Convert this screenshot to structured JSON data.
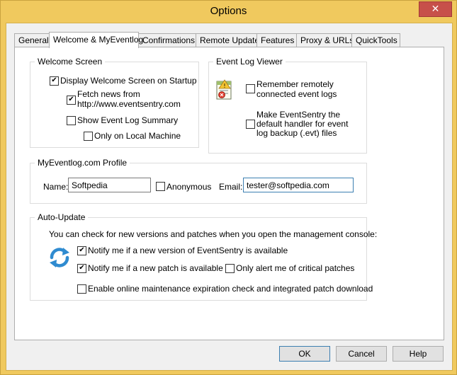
{
  "window": {
    "title": "Options",
    "close_glyph": "✕"
  },
  "tabs": [
    {
      "label": "General",
      "active": false
    },
    {
      "label": "Welcome & MyEventlog",
      "active": true
    },
    {
      "label": "Confirmations",
      "active": false
    },
    {
      "label": "Remote Update",
      "active": false
    },
    {
      "label": "Features",
      "active": false
    },
    {
      "label": "Proxy & URLs",
      "active": false
    },
    {
      "label": "QuickTools",
      "active": false
    }
  ],
  "welcome_screen": {
    "legend": "Welcome Screen",
    "display_on_startup": {
      "label": "Display Welcome Screen on Startup",
      "checked": true
    },
    "fetch_news": {
      "label_line1": "Fetch news from",
      "label_line2": "http://www.eventsentry.com",
      "checked": true
    },
    "show_summary": {
      "label": "Show Event Log Summary",
      "checked": false
    },
    "only_local": {
      "label": "Only on Local Machine",
      "checked": false
    }
  },
  "event_log_viewer": {
    "legend": "Event Log Viewer",
    "icon": "event-log-icon",
    "remember": {
      "label_line1": "Remember remotely",
      "label_line2": "connected event logs",
      "checked": false
    },
    "default_handler": {
      "label_line1": "Make EventSentry the",
      "label_line2": "default handler for event",
      "label_line3": "log backup (.evt) files",
      "checked": false
    }
  },
  "profile": {
    "legend": "MyEventlog.com Profile",
    "name_label": "Name:",
    "name_value": "Softpedia",
    "anonymous": {
      "label": "Anonymous",
      "checked": false
    },
    "email_label": "Email:",
    "email_value": "tester@softpedia.com"
  },
  "auto_update": {
    "legend": "Auto-Update",
    "intro": "You can check for new versions and patches when you open the management console:",
    "icon": "update-arrows-icon",
    "notify_version": {
      "label": "Notify me if a new version of EventSentry is available",
      "checked": true
    },
    "notify_patch": {
      "label": "Notify me if a new patch is available",
      "checked": true
    },
    "critical_only": {
      "label": "Only alert me of critical patches",
      "checked": false
    },
    "maintenance_check": {
      "label": "Enable online maintenance expiration check and integrated patch download",
      "checked": false
    }
  },
  "buttons": {
    "ok": "OK",
    "cancel": "Cancel",
    "help": "Help"
  },
  "colors": {
    "title_bar": "#f0c95e",
    "close_button": "#c7504a",
    "focus_border": "#3c7fb1"
  }
}
